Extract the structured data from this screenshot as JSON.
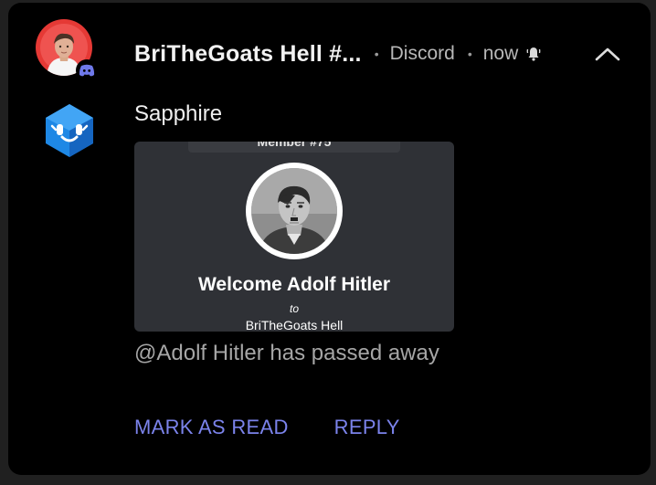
{
  "notification": {
    "server_name": "BriTheGoats Hell #...",
    "app_name": "Discord",
    "time": "now",
    "separator": "•",
    "icons": {
      "server_avatar": "server-avatar-icon",
      "app_badge": "discord-badge-icon",
      "alert": "bell-icon",
      "collapse": "chevron-up-icon",
      "sender_avatar": "bot-avatar-icon"
    }
  },
  "message": {
    "sender": "Sapphire",
    "text": "@Adolf Hitler has passed away",
    "embed": {
      "member_tab": "Member #75",
      "title": "Welcome Adolf Hitler",
      "to": "to",
      "server": "BriTheGoats Hell"
    }
  },
  "actions": {
    "mark_read": "MARK AS READ",
    "reply": "REPLY"
  },
  "colors": {
    "background": "#000000",
    "action": "#7b83eb",
    "embed_bg": "#2f3136",
    "server_avatar_ring": "#e53935",
    "bot_avatar": "#1e88e5"
  }
}
